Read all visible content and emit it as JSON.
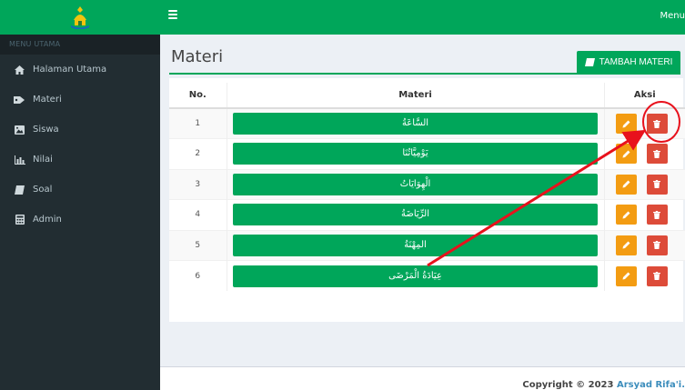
{
  "app": {
    "logo_icon": "mosque-logo-icon",
    "menu_label": "Menu"
  },
  "sidebar": {
    "header": "MENU UTAMA",
    "items": [
      {
        "label": "Halaman Utama",
        "icon": "home-icon"
      },
      {
        "label": "Materi",
        "icon": "tag-icon"
      },
      {
        "label": "Siswa",
        "icon": "image-icon"
      },
      {
        "label": "Nilai",
        "icon": "bar-chart-icon"
      },
      {
        "label": "Soal",
        "icon": "book-icon"
      },
      {
        "label": "Admin",
        "icon": "calculator-icon"
      }
    ]
  },
  "main": {
    "title": "Materi",
    "add_button": "TAMBAH MATERI",
    "table": {
      "headers": [
        "No.",
        "Materi",
        "Aksi"
      ],
      "rows": [
        {
          "no": "1",
          "materi": "السَّاعَةُ"
        },
        {
          "no": "2",
          "materi": "يَوْمِيَّاتُنَا"
        },
        {
          "no": "3",
          "materi": "الْهِوَايَاتُ"
        },
        {
          "no": "4",
          "materi": "الرِّيَاضَةُ"
        },
        {
          "no": "5",
          "materi": "المِهْنَةُ"
        },
        {
          "no": "6",
          "materi": "عِيَادَةُ الْمَرْضَى"
        }
      ]
    }
  },
  "footer": {
    "copyright_prefix": "Copyright © 2023",
    "copyright_author": "Arsyad Rifa'i."
  },
  "colors": {
    "primary": "#00a65a",
    "sidebar": "#222d32",
    "edit": "#f39c12",
    "delete": "#dd4b39",
    "annotation": "#e8111c"
  }
}
